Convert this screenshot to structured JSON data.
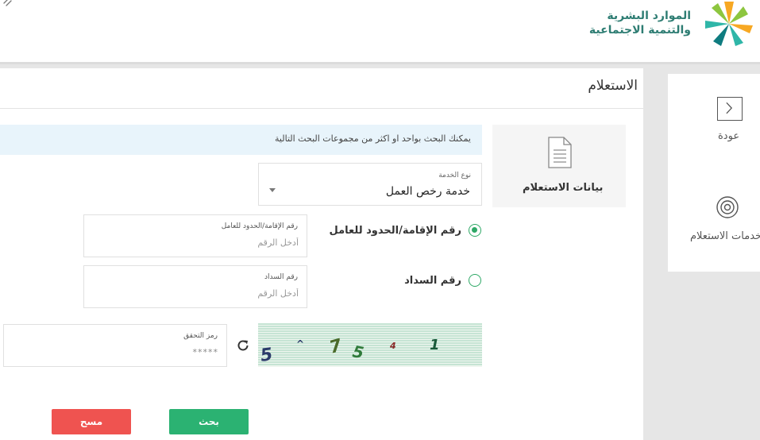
{
  "header": {
    "logo_line_1": "الموارد البشرية",
    "logo_line_2": "والتنمية الاجتماعية",
    "logo_icon": "ministry-logo-icon",
    "top_left_icon": "link-icon"
  },
  "sidebar": {
    "back_label": "عودة",
    "back_icon": "chevron-right-icon",
    "services_label": "خدمات الاستعلام",
    "services_icon": "broadcast-icon"
  },
  "main": {
    "title": "الاستعلام",
    "section_label": "بيانات الاستعلام",
    "section_icon": "document-icon",
    "info_text": "يمكنك البحث بواحد او اكثر من مجموعات البحث التالية",
    "service_type": {
      "label": "نوع الخدمة",
      "value": "خدمة رخص العمل"
    },
    "options": [
      {
        "label": "رقم الإقامة/الحدود للعامل",
        "checked": true
      },
      {
        "label": "رقم السداد",
        "checked": false
      }
    ],
    "residence_field": {
      "label": "رقم الإقامة/الحدود للعامل",
      "placeholder": "أدخل الرقم"
    },
    "payment_field": {
      "label": "رقم السداد",
      "placeholder": "أدخل الرقم"
    },
    "captcha_field": {
      "label": "رمز التحقق",
      "placeholder": "*****"
    },
    "captcha_chars": [
      "5",
      "^",
      "7",
      "5",
      "4",
      "1"
    ],
    "refresh_icon": "refresh-icon",
    "search_button": "بحث",
    "clear_button": "مسح"
  },
  "colors": {
    "primary_green": "#2bb272",
    "danger_red": "#ef5350",
    "info_bg": "#e8f4fb",
    "brand_teal": "#2e7d73"
  }
}
